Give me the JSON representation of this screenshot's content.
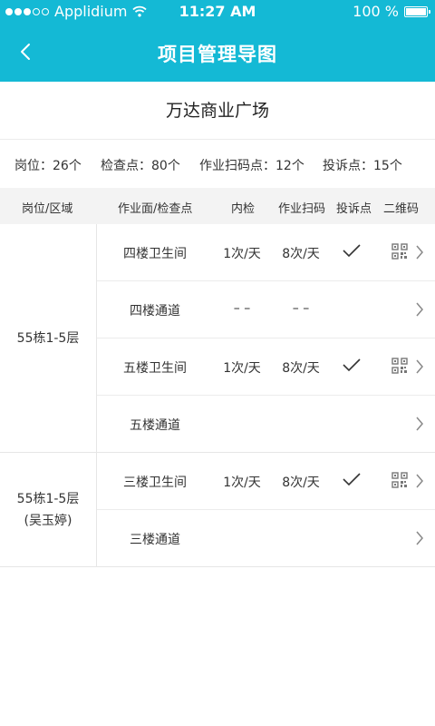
{
  "status_bar": {
    "carrier": "Applidium",
    "time": "11:27 AM",
    "battery": "100 %"
  },
  "nav": {
    "title": "项目管理导图"
  },
  "project": {
    "name": "万达商业广场"
  },
  "summary": {
    "posts": "岗位：26个",
    "checkpoints": "检查点：80个",
    "scan_points": "作业扫码点：12个",
    "complaint_points": "投诉点：15个"
  },
  "table": {
    "headers": {
      "area": "岗位/区域",
      "surface": "作业面/检查点",
      "inner_check": "内检",
      "scan": "作业扫码",
      "complaint": "投诉点",
      "qr": "二维码"
    },
    "groups": [
      {
        "area_line1": "55栋1-5层",
        "area_line2": "",
        "rows": [
          {
            "name": "四楼卫生间",
            "inner_check": "1次/天",
            "scan": "8次/天",
            "complaint": true,
            "qr": true
          },
          {
            "name": "四楼通道",
            "inner_check": "– –",
            "scan": "– –",
            "complaint": false,
            "qr": false
          },
          {
            "name": "五楼卫生间",
            "inner_check": "1次/天",
            "scan": "8次/天",
            "complaint": true,
            "qr": true
          },
          {
            "name": "五楼通道",
            "inner_check": "",
            "scan": "",
            "complaint": false,
            "qr": false
          }
        ]
      },
      {
        "area_line1": "55栋1-5层",
        "area_line2": "(吴玉婷)",
        "rows": [
          {
            "name": "三楼卫生间",
            "inner_check": "1次/天",
            "scan": "8次/天",
            "complaint": true,
            "qr": true
          },
          {
            "name": "三楼通道",
            "inner_check": "",
            "scan": "",
            "complaint": false,
            "qr": false
          }
        ]
      }
    ]
  },
  "icons": {
    "back": "chevron-left-icon",
    "check": "checkmark-icon",
    "qr": "qr-code-icon",
    "arrow": "chevron-right-icon"
  },
  "colors": {
    "primary": "#14b9d5",
    "header_bg": "#f3f3f3",
    "divider": "#e6e6e6"
  }
}
